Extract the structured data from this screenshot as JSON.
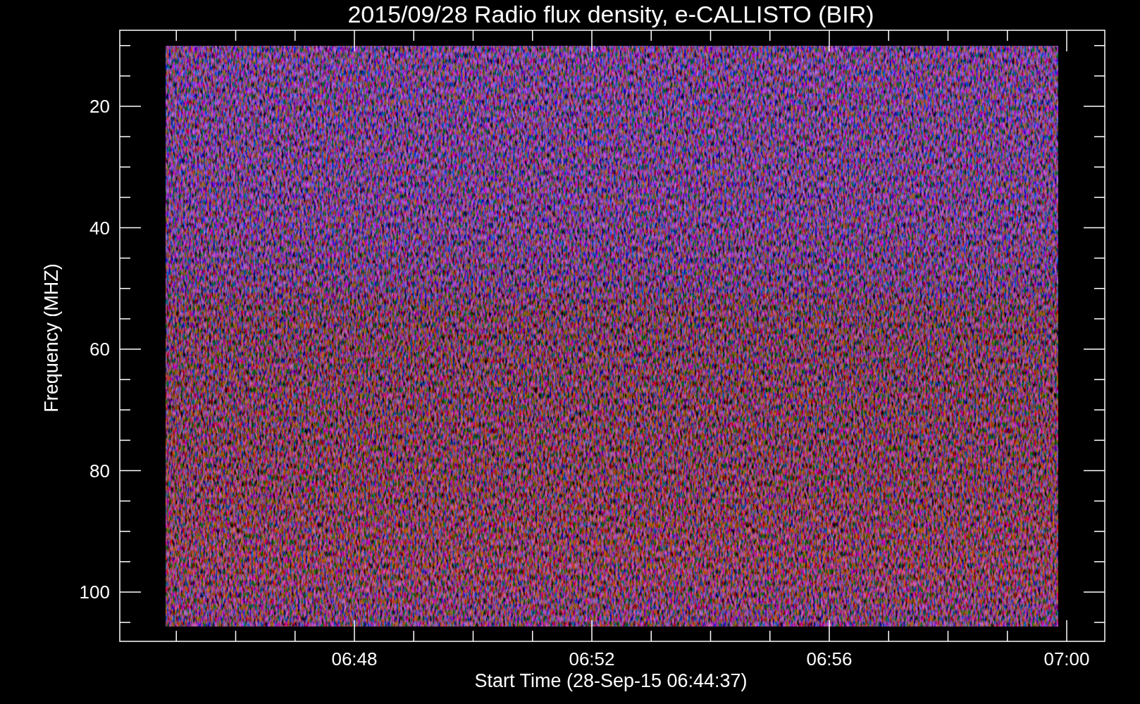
{
  "title": "2015/09/28  Radio flux density, e-CALLISTO (BIR)",
  "plot": {
    "ylabel": "Frequency (MHZ)",
    "xlabel": "Start Time (28-Sep-15 06:44:37)",
    "yticks": [
      "20",
      "40",
      "60",
      "80",
      "100"
    ],
    "xticks": [
      "06:48",
      "06:52",
      "06:56",
      "07:00"
    ]
  }
}
